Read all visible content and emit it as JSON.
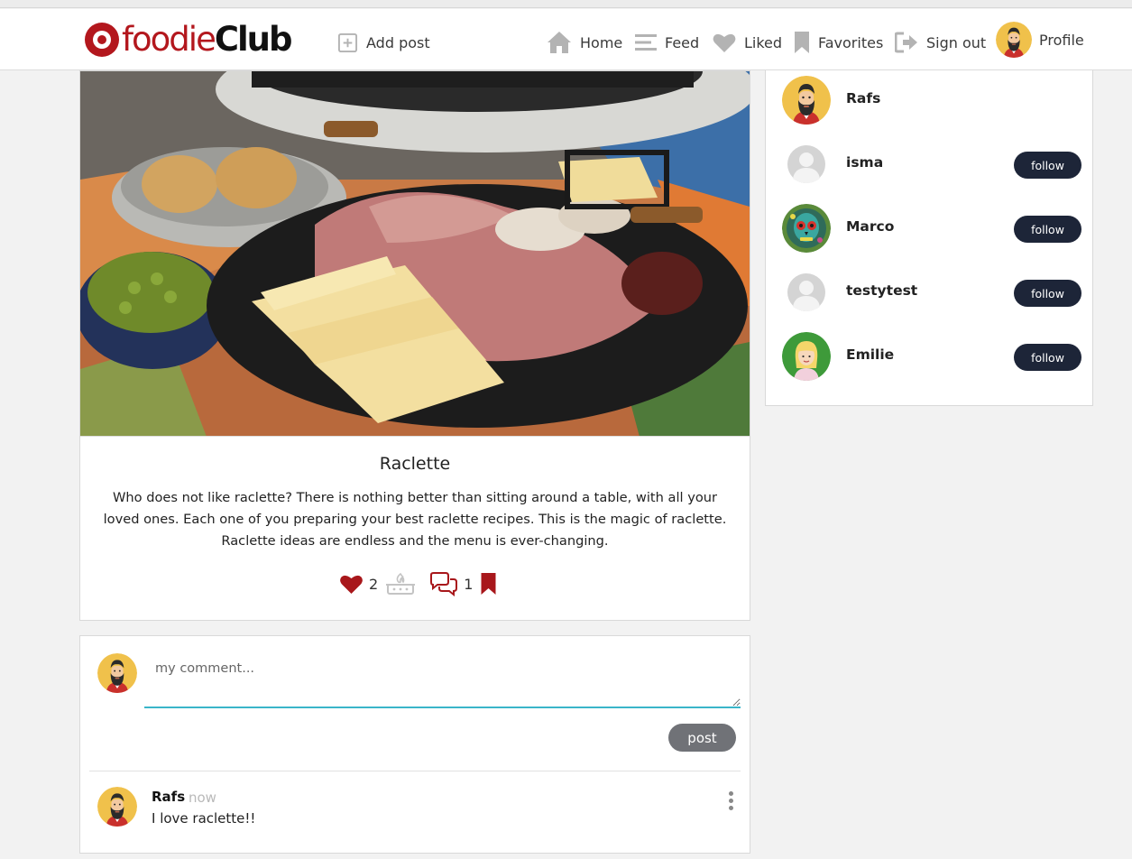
{
  "brand": {
    "part1": "foodie",
    "part2": "Club"
  },
  "nav": {
    "add_post": "Add post",
    "home": "Home",
    "feed": "Feed",
    "liked": "Liked",
    "favorites": "Favorites",
    "sign_out": "Sign out",
    "profile": "Profile"
  },
  "post": {
    "title": "Raclette",
    "body": "Who does not like raclette? There is nothing better than sitting around a table, with all your loved ones. Each one of you preparing your best raclette recipes. This is the magic of raclette. Raclette ideas are endless and the menu is ever-changing.",
    "likes": "2",
    "comments": "1"
  },
  "comment_form": {
    "placeholder": "my comment...",
    "post_label": "post"
  },
  "comments": [
    {
      "author": "Rafs",
      "time": "now",
      "text": "I love raclette!!"
    }
  ],
  "sidebar": {
    "users": [
      {
        "name": "Rafs",
        "follow": ""
      },
      {
        "name": "isma",
        "follow": "follow"
      },
      {
        "name": "Marco",
        "follow": "follow"
      },
      {
        "name": "testytest",
        "follow": "follow"
      },
      {
        "name": "Emilie",
        "follow": "follow"
      }
    ]
  },
  "colors": {
    "brand_red": "#b3171d",
    "follow_bg": "#1d2538",
    "post_btn": "#707277",
    "input_accent": "#3ab5c9"
  },
  "icons": [
    "plus-square-icon",
    "home-icon",
    "menu-icon",
    "heart-icon",
    "bookmark-icon",
    "sign-out-icon",
    "heart-icon",
    "cooking-pot-icon",
    "comments-icon",
    "bookmark-icon",
    "more-vertical-icon"
  ]
}
